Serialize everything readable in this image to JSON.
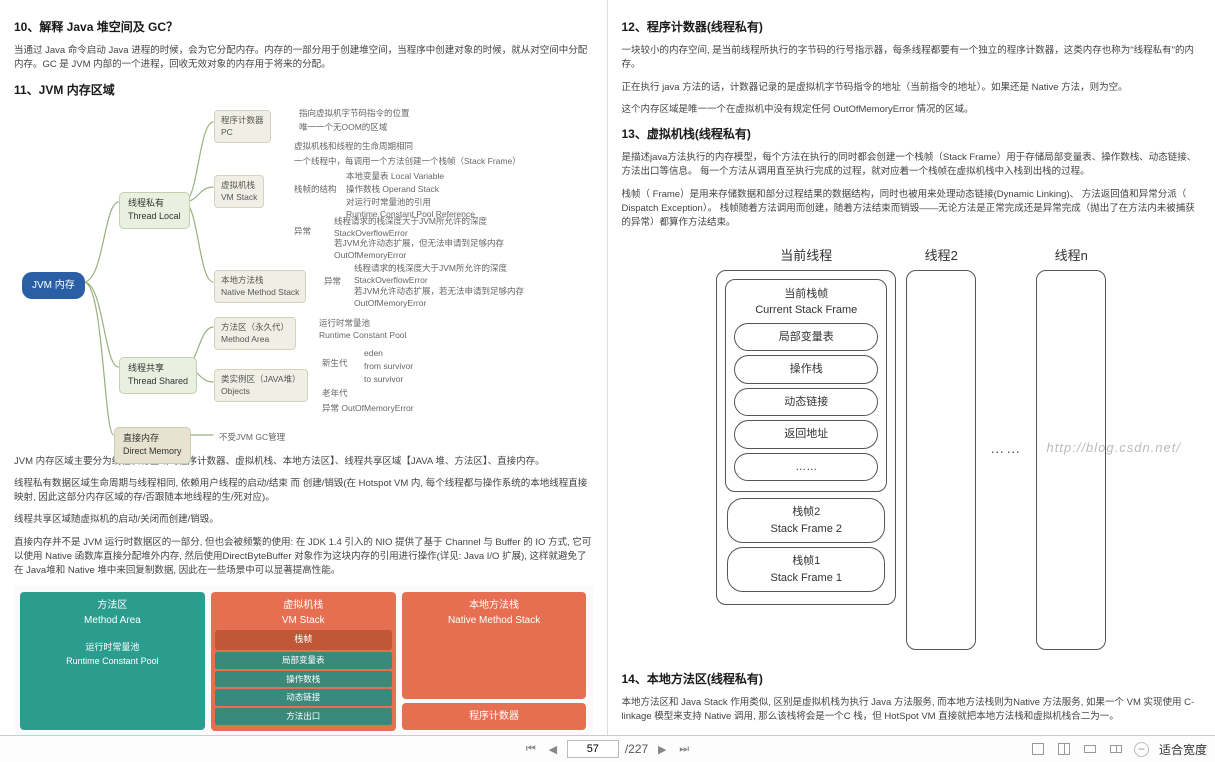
{
  "left": {
    "h10": "10、解释 Java 堆空间及 GC？",
    "p10": "当通过 Java 命令启动 Java 进程的时候，会为它分配内存。内存的一部分用于创建堆空间，当程序中创建对象的时候，就从对空间中分配内存。GC 是 JVM 内部的一个进程，回收无效对象的内存用于将来的分配。",
    "h11": "11、JVM 内存区域",
    "diagram": {
      "root": "JVM 内存",
      "threadLocal": "线程私有\nThread Local",
      "threadShared": "线程共享\nThread Shared",
      "directMemory": "直接内存\nDirect Memory",
      "pc": "程序计数器\nPC",
      "pc_a": "指向虚拟机字节码指令的位置",
      "pc_b": "唯一一个无OOM的区域",
      "vmstack": "虚拟机栈\nVM Stack",
      "vm_a": "虚拟机栈和线程的生命周期相同",
      "vm_b": "一个线程中，每调用一个方法创建一个栈帧（Stack Frame）",
      "vm_c": "栈帧的结构",
      "vm_c1": "本地变量表 Local Variable",
      "vm_c2": "操作数栈 Operand Stack",
      "vm_c3": "对运行时常量池的引用\nRuntime Constant Pool Reference",
      "vm_d": "异常",
      "vm_d1": "线程请求的栈深度大于JVM所允许的深度\nStackOverflowError",
      "vm_d2": "若JVM允许动态扩展，但无法申请到足够内存\nOutOfMemoryError",
      "native": "本地方法栈\nNative Method Stack",
      "nat_a": "异常",
      "nat_a1": "线程请求的栈深度大于JVM所允许的深度\nStackOverflowError",
      "nat_a2": "若JVM允许动态扩展，若无法申请到足够内存\nOutOfMemoryError",
      "methodArea": "方法区（永久代）\nMethod Area",
      "ma_a": "运行时常量池\nRuntime Constant Pool",
      "objects": "类实例区（JAVA堆）\nObjects",
      "obj_a": "新生代",
      "obj_a1": "eden",
      "obj_a2": "from survivor",
      "obj_a3": "to survivor",
      "obj_b": "老年代",
      "obj_c": "异常   OutOfMemoryError",
      "dm_a": "不受JVM GC管理"
    },
    "p11a": "JVM 内存区域主要分为线程私有区域【程序计数器、虚拟机栈、本地方法区】、线程共享区域【JAVA 堆、方法区】、直接内存。",
    "p11b": "线程私有数据区域生命周期与线程相同, 依赖用户线程的启动/结束 而 创建/销毁(在 Hotspot VM 内, 每个线程都与操作系统的本地线程直接映射, 因此这部分内存区域的存/否跟随本地线程的生/死对应)。",
    "p11c": "线程共享区域随虚拟机的启动/关闭而创建/销毁。",
    "p11d": "直接内存并不是 JVM 运行时数据区的一部分, 但也会被频繁的使用: 在 JDK 1.4 引入的 NIO 提供了基于 Channel 与 Buffer 的 IO 方式, 它可以使用 Native 函数库直接分配堆外内存, 然后使用DirectByteBuffer 对象作为这块内存的引用进行操作(详见: Java I/O 扩展), 这样就避免了在 Java堆和 Native 堆中来回复制数据, 因此在一些场景中可以显著提高性能。",
    "d2": {
      "methodArea": "方法区\nMethod Area",
      "rcp": "运行时常量池\nRuntime Constant Pool",
      "vmstack": "虚拟机栈\nVM Stack",
      "frame": "栈帧",
      "lvt": "局部变量表",
      "ops": "操作数栈",
      "dl": "动态链接",
      "ret": "方法出口",
      "nms": "本地方法栈\nNative Method Stack",
      "pc": "程序计数器"
    }
  },
  "right": {
    "h12": "12、程序计数器(线程私有)",
    "p12a": "一块较小的内存空间, 是当前线程所执行的字节码的行号指示器，每条线程都要有一个独立的程序计数器，这类内存也称为\"线程私有\"的内存。",
    "p12b": "正在执行 java 方法的话，计数器记录的是虚拟机字节码指令的地址（当前指令的地址）。如果还是 Native 方法，则为空。",
    "p12c": "这个内存区域是唯一一个在虚拟机中没有规定任何 OutOfMemoryError 情况的区域。",
    "h13": "13、虚拟机栈(线程私有)",
    "p13a": "是描述java方法执行的内存模型，每个方法在执行的同时都会创建一个栈帧（Stack Frame）用于存储局部变量表、操作数栈、动态链接、方法出口等信息。 每一个方法从调用直至执行完成的过程，就对应着一个栈帧在虚拟机栈中入栈到出栈的过程。",
    "p13b": "栈帧（ Frame）是用来存储数据和部分过程结果的数据结构，同时也被用来处理动态链接(Dynamic Linking)、 方法返回值和异常分派（ Dispatch Exception）。 栈帧随着方法调用而创建，随着方法结束而销毁——无论方法是正常完成还是异常完成（抛出了在方法内未被捕获的异常）都算作方法结束。",
    "stack": {
      "curThread": "当前线程",
      "thread2": "线程2",
      "threadN": "线程n",
      "curFrame": "当前栈帧\nCurrent Stack Frame",
      "lvt": "局部变量表",
      "ops": "操作栈",
      "dl": "动态链接",
      "ret": "返回地址",
      "other": "……",
      "f2": "栈帧2\nStack Frame 2",
      "f1": "栈帧1\nStack Frame 1",
      "dots": "……",
      "watermark": "http://blog.csdn.net/"
    },
    "h14": "14、本地方法区(线程私有)",
    "p14": "本地方法区和 Java Stack 作用类似, 区别是虚拟机栈为执行 Java 方法服务, 而本地方法栈则为Native 方法服务, 如果一个 VM 实现使用 C-linkage 模型来支持 Native 调用, 那么该栈将会是一个C 栈，但 HotSpot VM 直接就把本地方法栈和虚拟机栈合二为一。"
  },
  "toolbar": {
    "page": "57",
    "total": "227",
    "zoom": "适合宽度"
  }
}
